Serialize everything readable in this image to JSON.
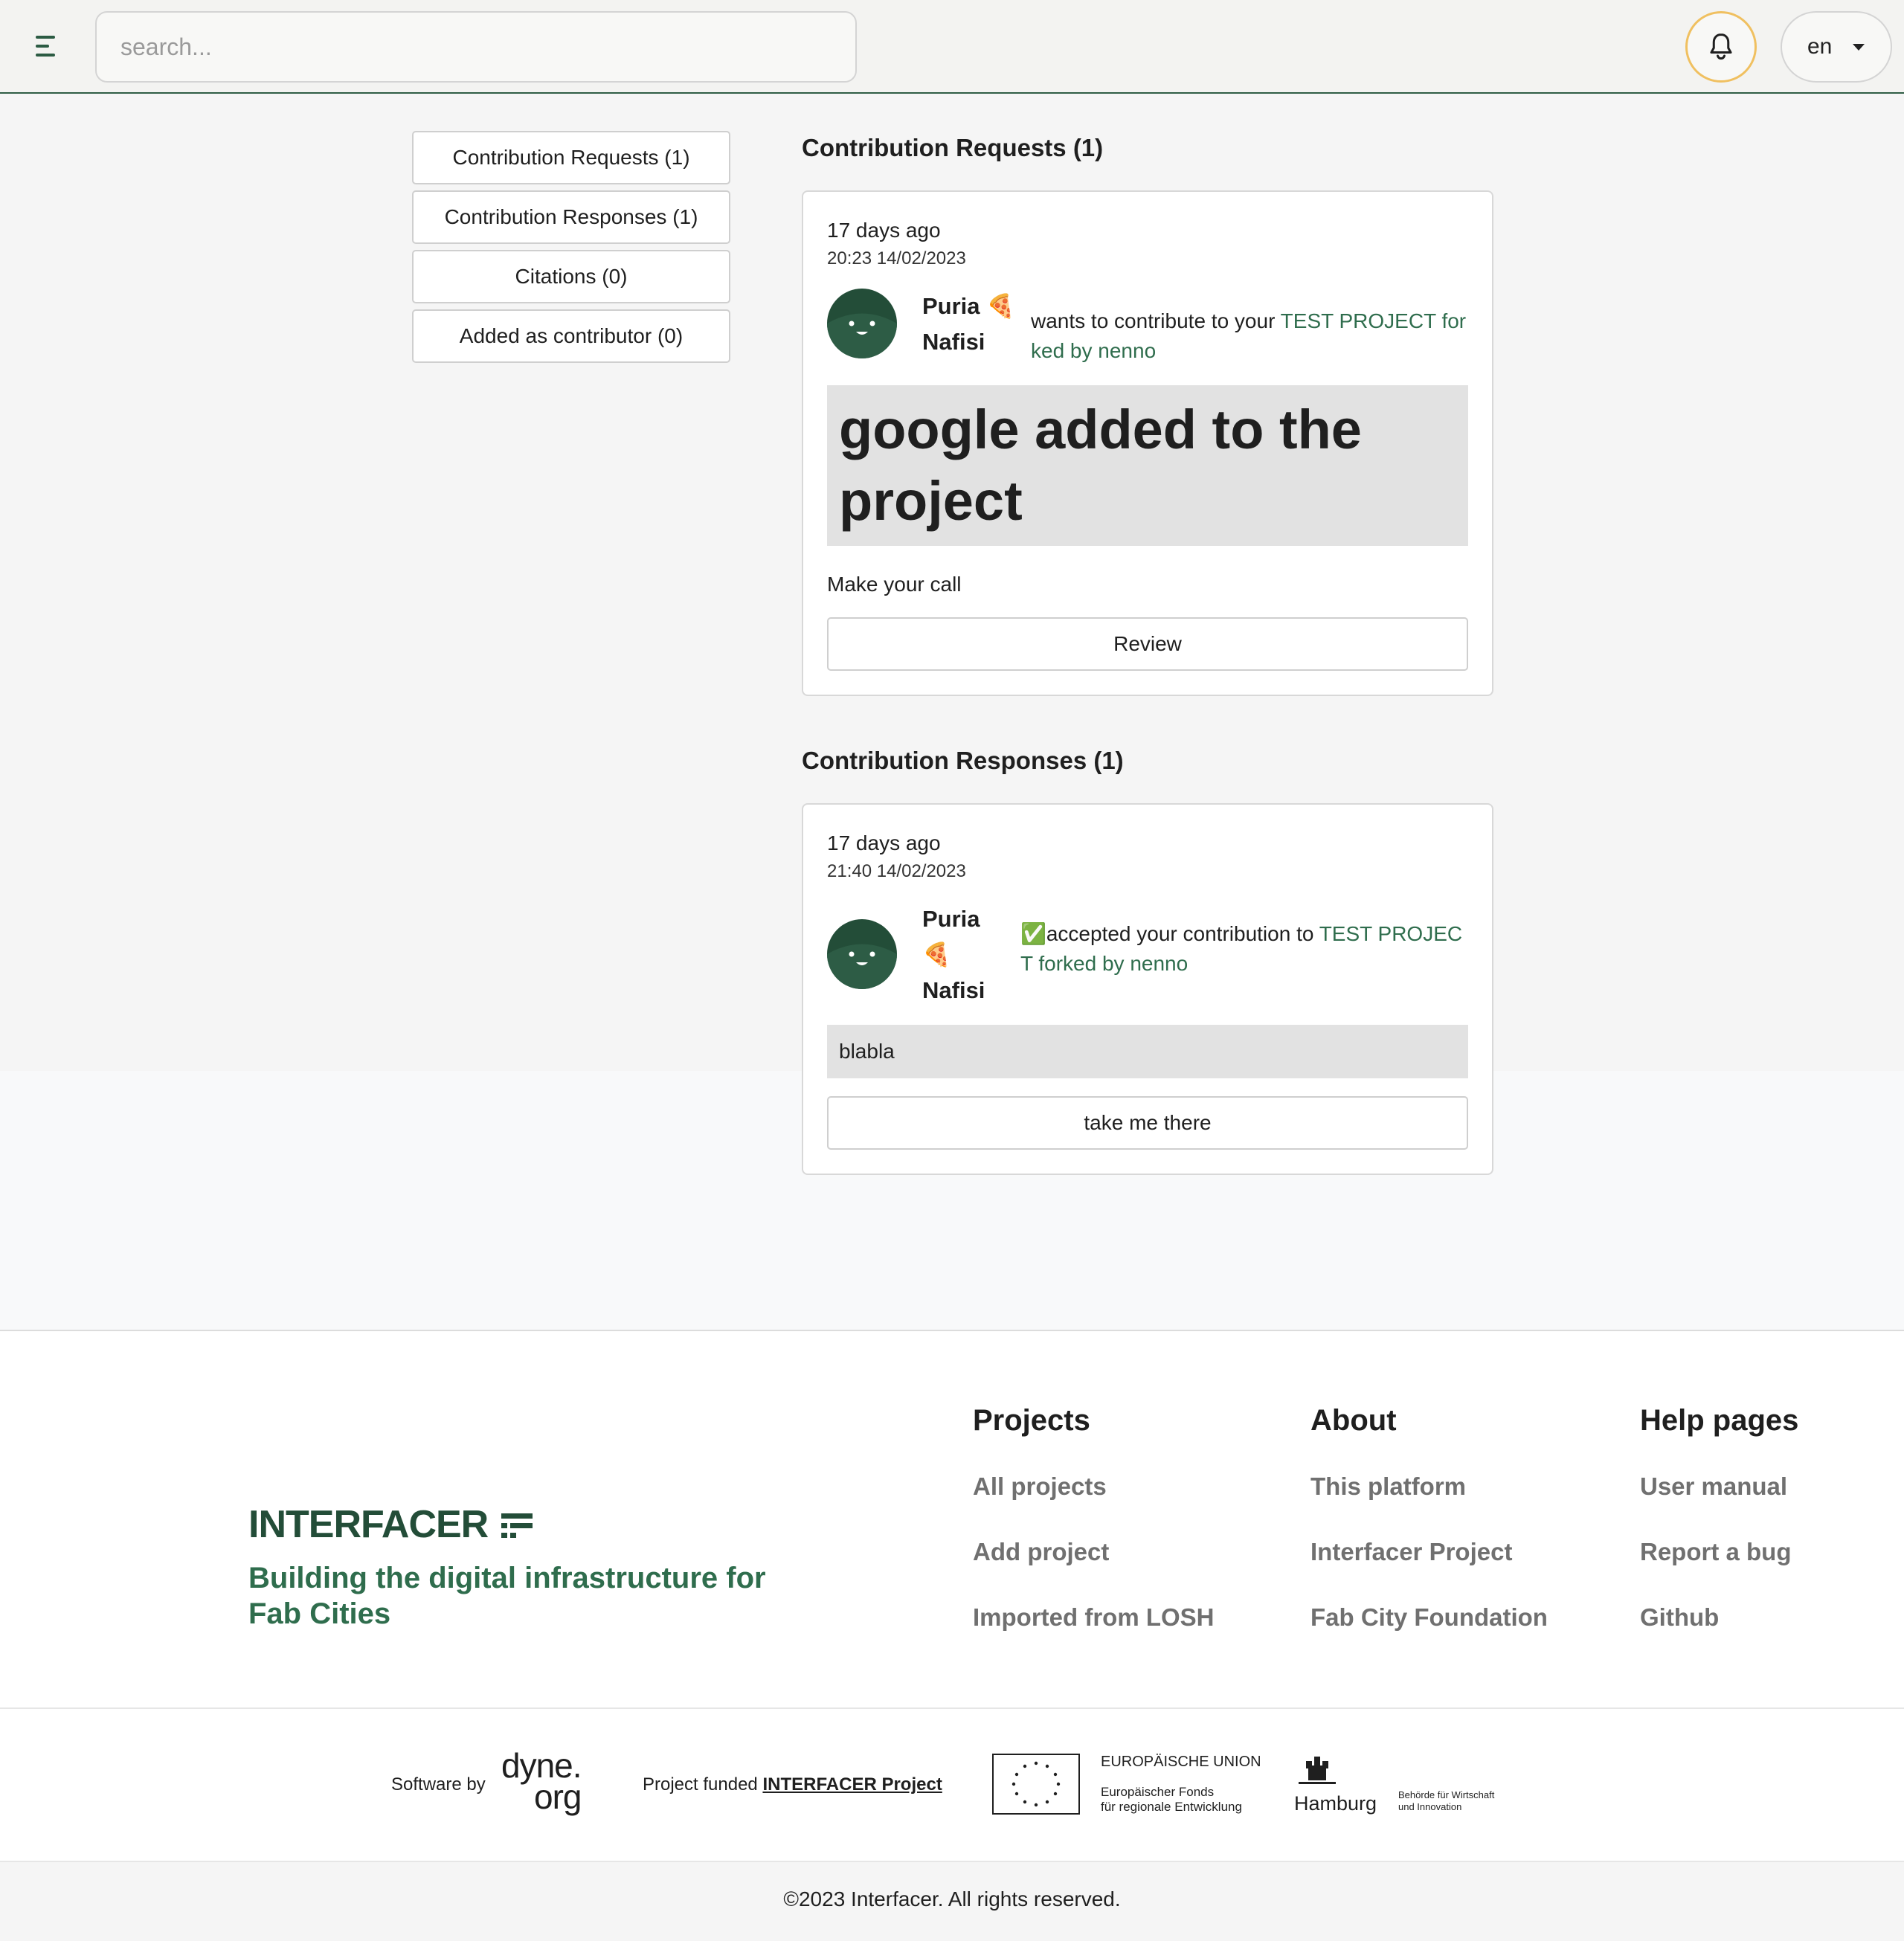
{
  "header": {
    "menu_icon": "hamburger-menu-icon",
    "search_placeholder": "search...",
    "bell_icon": "bell-icon",
    "language": "en",
    "accent_color": "#2f5d45"
  },
  "sidebar": {
    "items": [
      {
        "label": "Contribution Requests (1)"
      },
      {
        "label": "Contribution Responses (1)"
      },
      {
        "label": "Citations (0)"
      },
      {
        "label": "Added as contributor (0)"
      }
    ]
  },
  "requests": {
    "title": "Contribution Requests (1)",
    "item": {
      "ago": "17 days ago",
      "timestamp": "20:23 14/02/2023",
      "user_first": "Puria 🍕",
      "user_last": "Nafisi",
      "message": "wants to contribute to your ",
      "project_link": "TEST PROJECT forked by nenno",
      "quote": "google added to the project",
      "prompt": "Make your call",
      "button": "Review"
    }
  },
  "responses": {
    "title": "Contribution Responses (1)",
    "item": {
      "ago": "17 days ago",
      "timestamp": "21:40 14/02/2023",
      "user_first": "Puria",
      "user_emoji": "🍕",
      "user_last": "Nafisi",
      "message": "✅accepted your contribution to ",
      "project_link": "TEST PROJECT forked by nenno",
      "quote": "blabla",
      "button": "take me there"
    }
  },
  "footer": {
    "logo": "INTERFACER",
    "tagline": "Building the digital infrastructure for Fab Cities",
    "columns": [
      {
        "title": "Projects",
        "links": [
          "All projects",
          "Add project",
          "Imported from LOSH"
        ]
      },
      {
        "title": "About",
        "links": [
          "This platform",
          "Interfacer Project",
          "Fab City Foundation"
        ]
      },
      {
        "title": "Help pages",
        "links": [
          "User manual",
          "Report a bug",
          "Github"
        ]
      }
    ]
  },
  "sponsors": {
    "software_by": "Software by",
    "dyne_top": "dyne.",
    "dyne_bottom": "org",
    "funded_prefix": "Project funded ",
    "funded_link": "INTERFACER Project",
    "eu_title": "EUROPÄISCHE UNION",
    "eu_line1": "Europäischer Fonds",
    "eu_line2": "für regionale Entwicklung",
    "hamburg": "Hamburg",
    "hamburg_sub1": "Behörde für Wirtschaft",
    "hamburg_sub2": "und Innovation"
  },
  "copyright": "©2023 Interfacer. All rights reserved."
}
